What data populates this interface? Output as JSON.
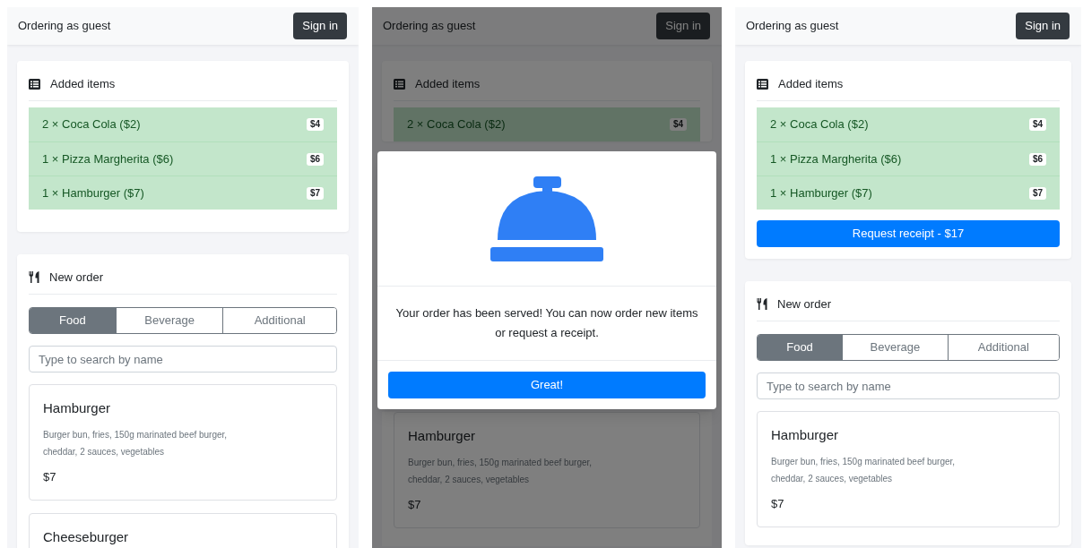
{
  "screens": [
    {
      "header": {
        "status": "Ordering as guest",
        "sign_in": "Sign in"
      },
      "added_items": {
        "title": "Added items",
        "items": [
          {
            "text": "2 × Coca Cola ($2)",
            "price": "$4"
          },
          {
            "text": "1 × Pizza Margherita ($6)",
            "price": "$6"
          },
          {
            "text": "1 × Hamburger ($7)",
            "price": "$7"
          }
        ]
      },
      "new_order": {
        "title": "New order",
        "tabs": [
          {
            "label": "Food",
            "selected": true
          },
          {
            "label": "Beverage",
            "selected": false
          },
          {
            "label": "Additional",
            "selected": false
          }
        ],
        "search": {
          "placeholder": "Type to search by name"
        }
      },
      "products": [
        {
          "name": "Hamburger",
          "description": "Burger bun, fries, 150g marinated beef burger, cheddar, 2 sauces, vegetables",
          "price": "$7"
        },
        {
          "name": "Cheeseburger"
        }
      ]
    },
    {
      "header": {
        "status": "Ordering as guest",
        "sign_in": "Sign in"
      },
      "added_items": {
        "title": "Added items",
        "items": [
          {
            "text": "2 × Coca Cola ($2)",
            "price": "$4"
          }
        ]
      },
      "products": [
        {
          "name": "Hamburger",
          "description": "Burger bun, fries, 150g marinated beef burger, cheddar, 2 sauces, vegetables",
          "price": "$7"
        }
      ],
      "modal": {
        "message": "Your order has been served! You can now order new items or request a receipt.",
        "button": "Great!"
      }
    },
    {
      "header": {
        "status": "Ordering as guest",
        "sign_in": "Sign in"
      },
      "added_items": {
        "title": "Added items",
        "items": [
          {
            "text": "2 × Coca Cola ($2)",
            "price": "$4"
          },
          {
            "text": "1 × Pizza Margherita ($6)",
            "price": "$6"
          },
          {
            "text": "1 × Hamburger ($7)",
            "price": "$7"
          }
        ],
        "receipt_button": "Request receipt - $17"
      },
      "new_order": {
        "title": "New order",
        "tabs": [
          {
            "label": "Food",
            "selected": true
          },
          {
            "label": "Beverage",
            "selected": false
          },
          {
            "label": "Additional",
            "selected": false
          }
        ],
        "search": {
          "placeholder": "Type to search by name"
        }
      },
      "products": [
        {
          "name": "Hamburger",
          "description": "Burger bun, fries, 150g marinated beef burger, cheddar, 2 sauces, vegetables",
          "price": "$7"
        }
      ]
    }
  ]
}
